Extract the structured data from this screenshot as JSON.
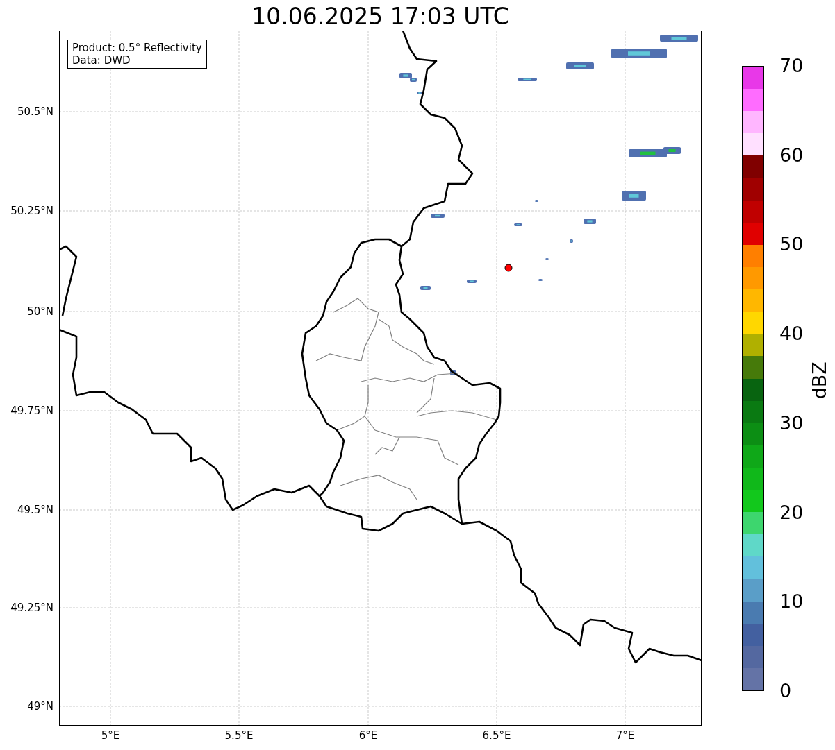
{
  "title": "10.06.2025 17:03 UTC",
  "info_box": {
    "lines": [
      "Product: 0.5° Reflectivity",
      "Data: DWD"
    ]
  },
  "y_ticks": [
    "50.5°N",
    "50.25°N",
    "50°N",
    "49.75°N",
    "49.5°N",
    "49.25°N",
    "49°N"
  ],
  "x_ticks": [
    "5°E",
    "5.5°E",
    "6°E",
    "6.5°E",
    "7°E"
  ],
  "colorbar": {
    "label": "dBZ",
    "ticks": [
      "70",
      "60",
      "50",
      "40",
      "30",
      "20",
      "10",
      "0"
    ],
    "bands": [
      {
        "color": "#e838e8"
      },
      {
        "color": "#ff6cff"
      },
      {
        "color": "#ffb6ff"
      },
      {
        "color": "#ffe0ff"
      },
      {
        "color": "#800000"
      },
      {
        "color": "#a00000"
      },
      {
        "color": "#c00000"
      },
      {
        "color": "#e00000"
      },
      {
        "color": "#ff7f00"
      },
      {
        "color": "#ff9900"
      },
      {
        "color": "#ffb700"
      },
      {
        "color": "#ffd700"
      },
      {
        "color": "#b0b000"
      },
      {
        "color": "#467a0a"
      },
      {
        "color": "#086410"
      },
      {
        "color": "#0a7a12"
      },
      {
        "color": "#0c8e14"
      },
      {
        "color": "#0fa818"
      },
      {
        "color": "#10b81a"
      },
      {
        "color": "#12c81c"
      },
      {
        "color": "#3dd66e"
      },
      {
        "color": "#5fd8c8"
      },
      {
        "color": "#62c0dc"
      },
      {
        "color": "#5a9ec8"
      },
      {
        "color": "#4a7bb0"
      },
      {
        "color": "#4360a0"
      },
      {
        "color": "#5468a0"
      },
      {
        "color": "#6473a6"
      }
    ]
  }
}
